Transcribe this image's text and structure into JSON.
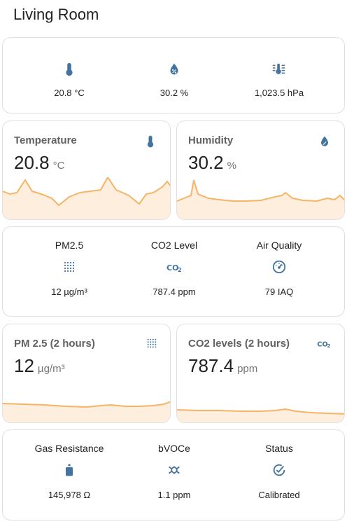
{
  "page": {
    "title": "Living Room"
  },
  "summary": [
    {
      "icon": "thermometer-icon",
      "value": "20.8 °C"
    },
    {
      "icon": "humidity-icon",
      "value": "30.2 %"
    },
    {
      "icon": "pressure-icon",
      "value": "1,023.5 hPa"
    }
  ],
  "graphs_row1": [
    {
      "name": "Temperature",
      "value": "20.8",
      "unit": "°C",
      "icon": "thermometer-icon"
    },
    {
      "name": "Humidity",
      "value": "30.2",
      "unit": "%",
      "icon": "humidity-icon"
    }
  ],
  "air": [
    {
      "label": "PM2.5",
      "icon": "pm-dots-icon",
      "value": "12 µg/m³"
    },
    {
      "label": "CO2 Level",
      "icon": "co2-icon",
      "value": "787.4 ppm"
    },
    {
      "label": "Air Quality",
      "icon": "gauge-icon",
      "value": "79 IAQ"
    }
  ],
  "graphs_row2": [
    {
      "name": "PM 2.5 (2 hours)",
      "value": "12",
      "unit": "µg/m³",
      "icon": "pm-dots-icon"
    },
    {
      "name": "CO2 levels (2 hours)",
      "value": "787.4",
      "unit": "ppm",
      "icon": "co2-icon"
    }
  ],
  "gas": [
    {
      "label": "Gas Resistance",
      "icon": "gas-cylinder-icon",
      "value": "145,978 Ω"
    },
    {
      "label": "bVOCe",
      "icon": "molecule-icon",
      "value": "1.1 ppm"
    },
    {
      "label": "Status",
      "icon": "check-circle-icon",
      "value": "Calibrated"
    }
  ],
  "colors": {
    "accent": "#44739e",
    "line": "#f7b466",
    "fill": "#fdeede"
  }
}
